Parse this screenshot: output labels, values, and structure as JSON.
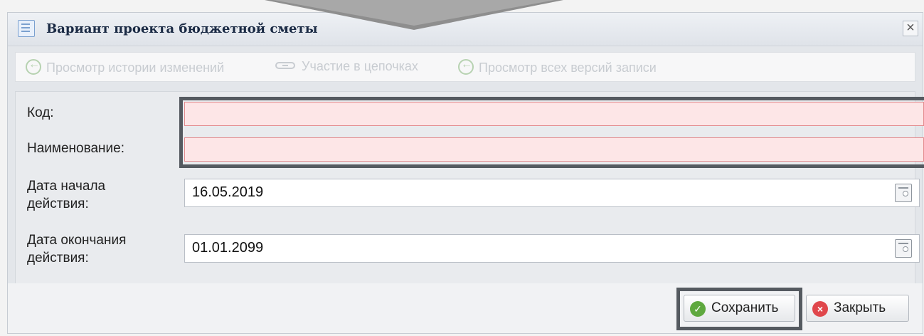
{
  "window": {
    "title": "Вариант проекта бюджетной сметы",
    "close_glyph": "×"
  },
  "toolbar": {
    "items": [
      {
        "label": "Просмотр истории изменений",
        "icon": "history-icon",
        "enabled": false
      },
      {
        "label": "Участие в цепочках",
        "icon": "chain-icon",
        "enabled": false
      },
      {
        "label": "Просмотр всех версий записи",
        "icon": "history-icon",
        "enabled": false
      }
    ]
  },
  "form": {
    "code": {
      "label": "Код:",
      "value": "",
      "invalid": true
    },
    "name": {
      "label": "Наименование:",
      "value": "",
      "invalid": true
    },
    "start_date": {
      "label_line1": "Дата начала",
      "label_line2": "действия:",
      "value": "16.05.2019"
    },
    "end_date": {
      "label_line1": "Дата окончания",
      "label_line2": "действия:",
      "value": "01.01.2099"
    }
  },
  "buttons": {
    "save": "Сохранить",
    "close": "Закрыть",
    "save_icon_glyph": "✓",
    "close_icon_glyph": "×"
  },
  "colors": {
    "invalid_bg": "#fde6e7",
    "invalid_border": "#e38b8e",
    "highlight": "#555a60",
    "save_icon": "#5ea83e",
    "close_icon": "#e0474c"
  }
}
